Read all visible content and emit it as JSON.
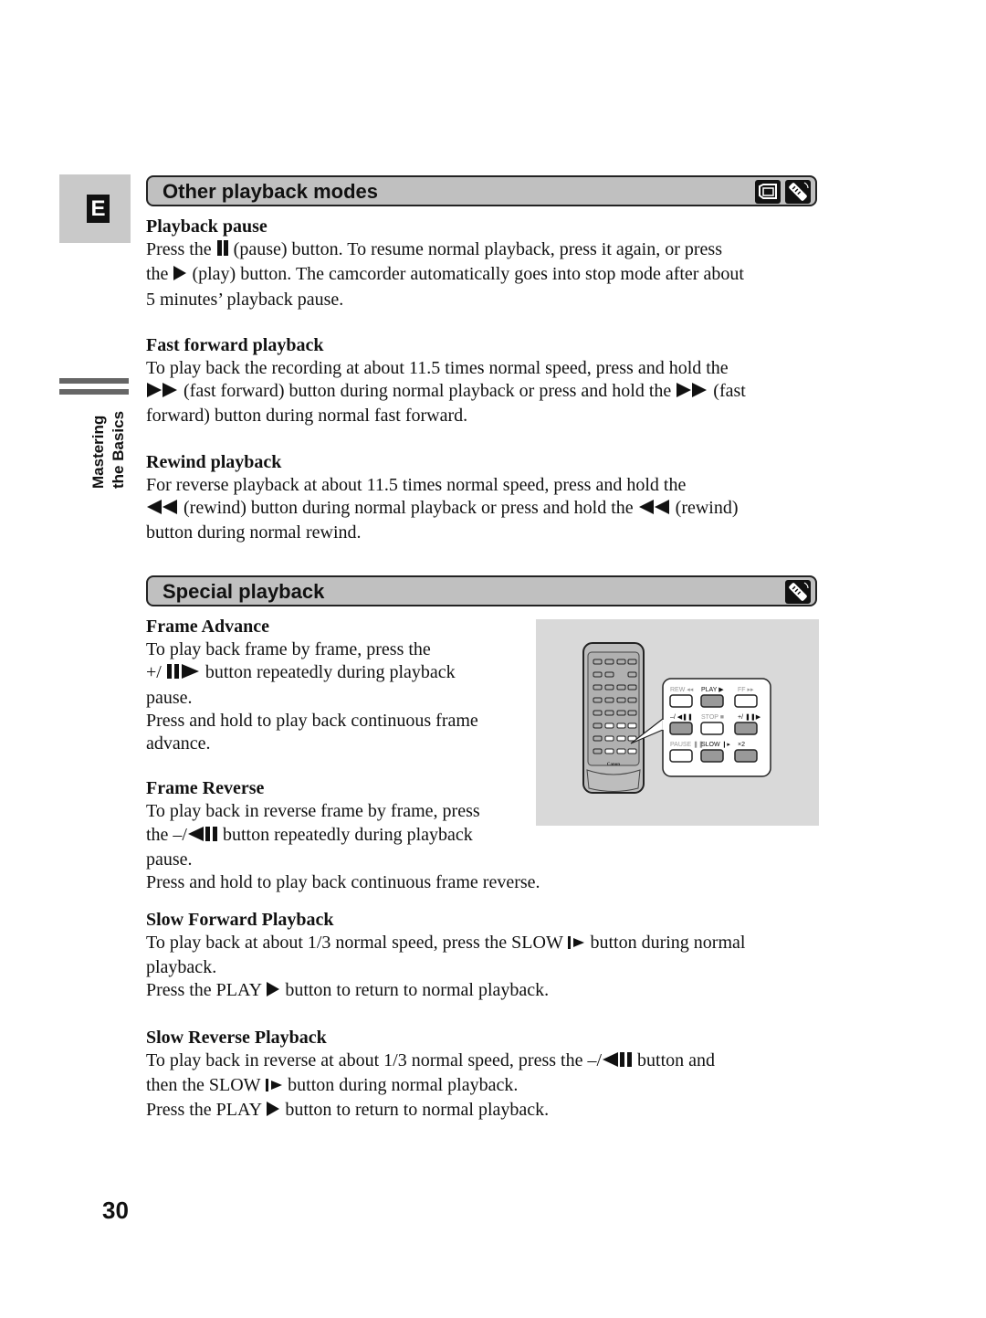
{
  "side": {
    "language_letter": "E",
    "section_label_line1": "Mastering",
    "section_label_line2": "the Basics"
  },
  "section1": {
    "title": "Other playback modes",
    "icons": [
      "camcorder-icon",
      "remote-control-icon"
    ],
    "subsections": [
      {
        "heading": "Playback pause",
        "lines": [
          [
            "Press the ",
            "pause-icon",
            " (pause) button. To resume normal playback, press it again, or press"
          ],
          [
            "the ",
            "play-icon",
            " (play) button. The camcorder automatically goes into stop mode after about"
          ],
          [
            "5 minutes’ playback pause."
          ]
        ]
      },
      {
        "heading": "Fast forward playback",
        "lines": [
          [
            "To play back the recording at about 11.5 times normal speed, press and hold the"
          ],
          [
            "fast-forward-icon",
            " (fast forward) button during normal playback or press and hold the ",
            "fast-forward-icon",
            " (fast"
          ],
          [
            "forward) button during normal fast forward."
          ]
        ]
      },
      {
        "heading": "Rewind playback",
        "lines": [
          [
            "For reverse playback at about 11.5 times normal speed, press and hold the"
          ],
          [
            "rewind-icon",
            " (rewind) button during normal playback or press and hold the ",
            "rewind-icon",
            " (rewind)"
          ],
          [
            "button during normal rewind."
          ]
        ]
      }
    ]
  },
  "section2": {
    "title": "Special playback",
    "icons": [
      "remote-control-icon"
    ],
    "subsections": [
      {
        "heading": "Frame Advance",
        "lines": [
          [
            "To play back frame by frame, press the"
          ],
          [
            "+/ ",
            "frame-advance-icon",
            " button repeatedly during playback"
          ],
          [
            "pause."
          ],
          [
            "Press and hold to play back continuous frame"
          ],
          [
            "advance."
          ]
        ]
      },
      {
        "heading": "Frame Reverse",
        "lines": [
          [
            "To play back in reverse frame by frame, press"
          ],
          [
            "the –/",
            "frame-reverse-icon",
            " button repeatedly during playback"
          ],
          [
            "pause."
          ],
          [
            "Press and hold to play back continuous frame reverse."
          ]
        ]
      },
      {
        "heading": "Slow Forward Playback",
        "lines": [
          [
            "To play back at about 1/3 normal speed, press the SLOW ",
            "slow-icon",
            " button during normal"
          ],
          [
            "playback."
          ],
          [
            "Press the PLAY ",
            "play-icon",
            " button to return to normal playback."
          ]
        ]
      },
      {
        "heading": "Slow Reverse Playback",
        "lines": [
          [
            "To play back in reverse at about 1/3 normal speed, press the –/",
            "frame-reverse-icon",
            " button and"
          ],
          [
            "then the SLOW ",
            "slow-icon",
            " button during normal playback."
          ],
          [
            "Press the PLAY ",
            "play-icon",
            " button to return to normal playback."
          ]
        ]
      }
    ]
  },
  "illustration": {
    "brand": "Canon",
    "buttons": [
      {
        "label": "REW",
        "symbol": "◂◂",
        "highlighted": false
      },
      {
        "label": "PLAY",
        "symbol": "▶",
        "highlighted": true
      },
      {
        "label": "FF",
        "symbol": "▸▸",
        "highlighted": false
      },
      {
        "label": "–/",
        "symbol": "◀❚❚",
        "highlighted": true
      },
      {
        "label": "STOP",
        "symbol": "■",
        "highlighted": false
      },
      {
        "label": "+/",
        "symbol": "❚❚▶",
        "highlighted": true
      },
      {
        "label": "PAUSE",
        "symbol": "❚❚",
        "highlighted": false
      },
      {
        "label": "SLOW",
        "symbol": "❙▸",
        "highlighted": true
      },
      {
        "label": "×2",
        "symbol": "",
        "highlighted": true
      }
    ]
  },
  "page_number": "30"
}
